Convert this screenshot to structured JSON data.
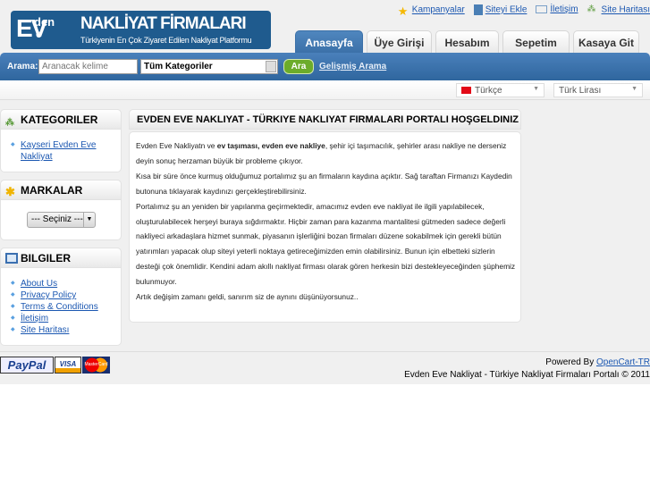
{
  "logo": {
    "ev": "EV",
    "den": "den",
    "e": "e",
    "title": "NAKLİYAT FİRMALARI",
    "tagline": "Türkiyenin En Çok Ziyaret Edilen Nakliyat Platformu"
  },
  "top_links": [
    "Kampanyalar",
    "Siteyi Ekle",
    "İletişim",
    "Site Haritası"
  ],
  "tabs": [
    "Anasayfa",
    "Üye Girişi",
    "Hesabım",
    "Sepetim",
    "Kasaya Git"
  ],
  "search": {
    "label": "Arama:",
    "placeholder": "Aranacak kelime",
    "category": "Tüm Kategoriler",
    "button": "Ara",
    "advanced": "Gelişmiş Arama"
  },
  "language": "Türkçe",
  "currency": "Türk Lirası",
  "categories": {
    "title": "KATEGORILER",
    "items": [
      "Kayseri Evden Eve Nakliyat"
    ]
  },
  "brands": {
    "title": "MARKALAR",
    "select": "--- Seçiniz ---"
  },
  "info": {
    "title": "BILGILER",
    "items": [
      "About Us",
      "Privacy Policy",
      "Terms & Conditions",
      "İletişim",
      "Site Haritası"
    ]
  },
  "main": {
    "title": "EVDEN EVE NAKLIYAT - TÜRKIYE NAKLIYAT FIRMALARI PORTALI HOŞGELDINIZ",
    "p1a": "Evden Eve Nakliyatn ve ",
    "p1b": "ev taşıması, evden eve nakliye",
    "p1c": ", şehir içi taşımacılık, şehirler arası nakliye ne derseniz deyin sonuç herzaman büyük bir probleme çıkıyor.",
    "p2": "Kısa bir süre önce kurmuş olduğumuz portalımız şu an firmaların kaydına açıktır. Sağ taraftan Firmanızı Kaydedin butonuna tıklayarak kaydınızı gerçekleştirebilirsiniz.",
    "p3": "Portalımız şu an yeniden bir yapılanma geçirmektedir, amacımız evden eve nakliyat ile ilgili yapılabilecek, oluşturulabilecek herşeyi buraya sığdırmaktır. Hiçbir zaman para kazanma mantalitesi gütmeden sadece değerli nakliyeci arkadaşlara hizmet sunmak, piyasanın işlerliğini bozan firmaları düzene sokabilmek için gerekli bütün yatırımları yapacak olup siteyi yeterli noktaya getireceğimizden emin olabilirsiniz. Bunun için elbetteki sizlerin desteği çok önemlidir. Kendini adam akıllı nakliyat firması olarak gören herkesin bizi destekleyeceğinden şüphemiz bulunmuyor.",
    "p4": "Artık değişim zamanı geldi, sanırım siz de aynını düşünüyorsunuz.."
  },
  "payments": [
    "PayPal",
    "VISA",
    "MasterCard"
  ],
  "footer": {
    "powered": "Powered By ",
    "powered_link": "OpenCart-TR",
    "copyright": "Evden Eve Nakliyat - Türkiye Nakliyat Firmaları Portalı © 2011"
  }
}
